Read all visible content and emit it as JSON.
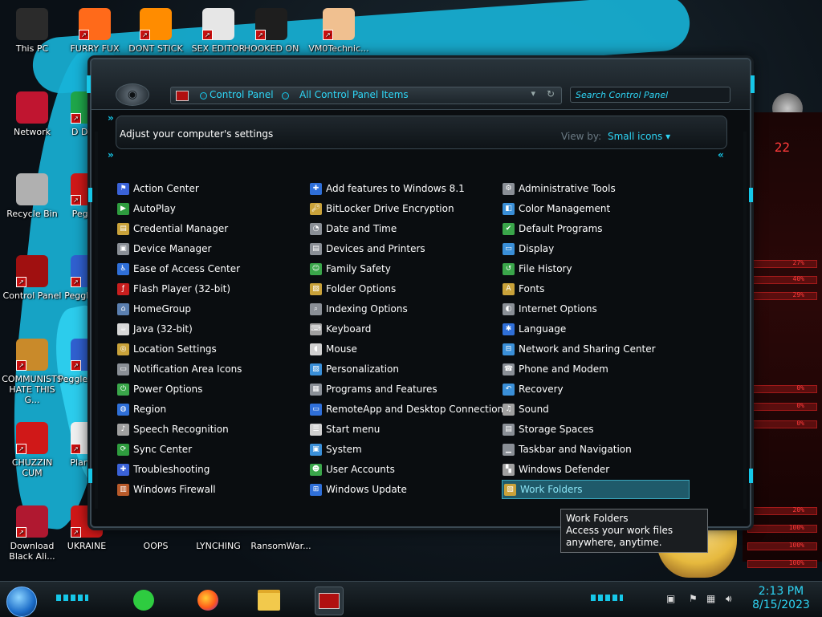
{
  "desktop_icons": [
    {
      "label": "This PC"
    },
    {
      "label": "FURRY FUX"
    },
    {
      "label": "DONT STICK"
    },
    {
      "label": "SEX EDITOR"
    },
    {
      "label": "HOOKED ON"
    },
    {
      "label": "VM0Technic..."
    },
    {
      "label": "Network"
    },
    {
      "label": "D DUM"
    },
    {
      "label": "Recycle Bin"
    },
    {
      "label": "Peggle"
    },
    {
      "label": "Control Panel"
    },
    {
      "label": "Peggle De"
    },
    {
      "label": "COMMUNISTS HATE THIS G..."
    },
    {
      "label": "Peggle of Wa"
    },
    {
      "label": "CHUZZIN CUM"
    },
    {
      "label": "Plan Zo"
    },
    {
      "label": "Download Black Ali..."
    },
    {
      "label": "UKRAINE"
    },
    {
      "label": "OOPS"
    },
    {
      "label": "LYNCHING"
    },
    {
      "label": "RansomWar..."
    }
  ],
  "window": {
    "breadcrumb": [
      "Control Panel",
      "All Control Panel Items"
    ],
    "search_placeholder": "Search Control Panel",
    "heading": "Adjust your computer's settings",
    "view_by_label": "View by:",
    "view_by_value": "Small icons"
  },
  "items": [
    {
      "label": "Action Center",
      "icon": "flag-icon",
      "color": "#3a62d8"
    },
    {
      "label": "AutoPlay",
      "icon": "autoplay-icon",
      "color": "#2e9c3e"
    },
    {
      "label": "Credential Manager",
      "icon": "vault-icon",
      "color": "#c9a23a"
    },
    {
      "label": "Device Manager",
      "icon": "device-manager-icon",
      "color": "#8a8f96"
    },
    {
      "label": "Ease of Access Center",
      "icon": "accessibility-icon",
      "color": "#2f6fd8"
    },
    {
      "label": "Flash Player (32-bit)",
      "icon": "flash-icon",
      "color": "#c81e1e"
    },
    {
      "label": "HomeGroup",
      "icon": "homegroup-icon",
      "color": "#5a7fb0"
    },
    {
      "label": "Java (32-bit)",
      "icon": "java-icon",
      "color": "#d8d8d8"
    },
    {
      "label": "Location Settings",
      "icon": "location-icon",
      "color": "#c9a23a"
    },
    {
      "label": "Notification Area Icons",
      "icon": "notification-icon",
      "color": "#8a8f96"
    },
    {
      "label": "Power Options",
      "icon": "power-icon",
      "color": "#3aa64a"
    },
    {
      "label": "Region",
      "icon": "globe-icon",
      "color": "#2f6fd8"
    },
    {
      "label": "Speech Recognition",
      "icon": "microphone-icon",
      "color": "#a0a0a0"
    },
    {
      "label": "Sync Center",
      "icon": "sync-icon",
      "color": "#2e9c3e"
    },
    {
      "label": "Troubleshooting",
      "icon": "troubleshoot-icon",
      "color": "#3a62d8"
    },
    {
      "label": "Windows Firewall",
      "icon": "firewall-icon",
      "color": "#b85a2a"
    },
    {
      "label": "Add features to Windows 8.1",
      "icon": "add-features-icon",
      "color": "#2f6fd8"
    },
    {
      "label": "BitLocker Drive Encryption",
      "icon": "bitlocker-icon",
      "color": "#c9a23a"
    },
    {
      "label": "Date and Time",
      "icon": "clock-icon",
      "color": "#8a8f96"
    },
    {
      "label": "Devices and Printers",
      "icon": "printer-icon",
      "color": "#8a8f96"
    },
    {
      "label": "Family Safety",
      "icon": "family-icon",
      "color": "#3aa64a"
    },
    {
      "label": "Folder Options",
      "icon": "folder-options-icon",
      "color": "#c9a23a"
    },
    {
      "label": "Indexing Options",
      "icon": "indexing-icon",
      "color": "#8a8f96"
    },
    {
      "label": "Keyboard",
      "icon": "keyboard-icon",
      "color": "#a0a0a0"
    },
    {
      "label": "Mouse",
      "icon": "mouse-icon",
      "color": "#d0d0d0"
    },
    {
      "label": "Personalization",
      "icon": "personalization-icon",
      "color": "#3a8fd8"
    },
    {
      "label": "Programs and Features",
      "icon": "programs-icon",
      "color": "#8a8f96"
    },
    {
      "label": "RemoteApp and Desktop Connections",
      "icon": "remote-desktop-icon",
      "color": "#2f6fd8"
    },
    {
      "label": "Start menu",
      "icon": "start-menu-icon",
      "color": "#d0d0d0"
    },
    {
      "label": "System",
      "icon": "system-icon",
      "color": "#3a8fd8"
    },
    {
      "label": "User Accounts",
      "icon": "users-icon",
      "color": "#3aa64a"
    },
    {
      "label": "Windows Update",
      "icon": "windows-update-icon",
      "color": "#2f6fd8"
    },
    {
      "label": "Administrative Tools",
      "icon": "admin-tools-icon",
      "color": "#8a8f96"
    },
    {
      "label": "Color Management",
      "icon": "color-management-icon",
      "color": "#3a8fd8"
    },
    {
      "label": "Default Programs",
      "icon": "default-programs-icon",
      "color": "#3aa64a"
    },
    {
      "label": "Display",
      "icon": "display-icon",
      "color": "#3a8fd8"
    },
    {
      "label": "File History",
      "icon": "file-history-icon",
      "color": "#3aa64a"
    },
    {
      "label": "Fonts",
      "icon": "fonts-icon",
      "color": "#c9a23a"
    },
    {
      "label": "Internet Options",
      "icon": "internet-options-icon",
      "color": "#8a8f96"
    },
    {
      "label": "Language",
      "icon": "language-icon",
      "color": "#2f6fd8"
    },
    {
      "label": "Network and Sharing Center",
      "icon": "network-sharing-icon",
      "color": "#3a8fd8"
    },
    {
      "label": "Phone and Modem",
      "icon": "phone-icon",
      "color": "#8a8f96"
    },
    {
      "label": "Recovery",
      "icon": "recovery-icon",
      "color": "#3a8fd8"
    },
    {
      "label": "Sound",
      "icon": "sound-icon",
      "color": "#a0a0a0"
    },
    {
      "label": "Storage Spaces",
      "icon": "storage-icon",
      "color": "#8a8f96"
    },
    {
      "label": "Taskbar and Navigation",
      "icon": "taskbar-icon",
      "color": "#8a8f96"
    },
    {
      "label": "Windows Defender",
      "icon": "defender-icon",
      "color": "#a0a0a0"
    },
    {
      "label": "Work Folders",
      "icon": "work-folders-icon",
      "color": "#c9a23a"
    }
  ],
  "tooltip": {
    "title": "Work Folders",
    "body": "Access your work files anywhere, anytime."
  },
  "side_panel_percents": [
    "27%",
    "40%",
    "29%",
    "0%",
    "0%",
    "0%",
    "20%",
    "100%",
    "100%",
    "100%"
  ],
  "side_panel_label": "22",
  "clock": {
    "time": "2:13 PM",
    "date": "8/15/2023"
  },
  "accent": "#2ed5f5"
}
